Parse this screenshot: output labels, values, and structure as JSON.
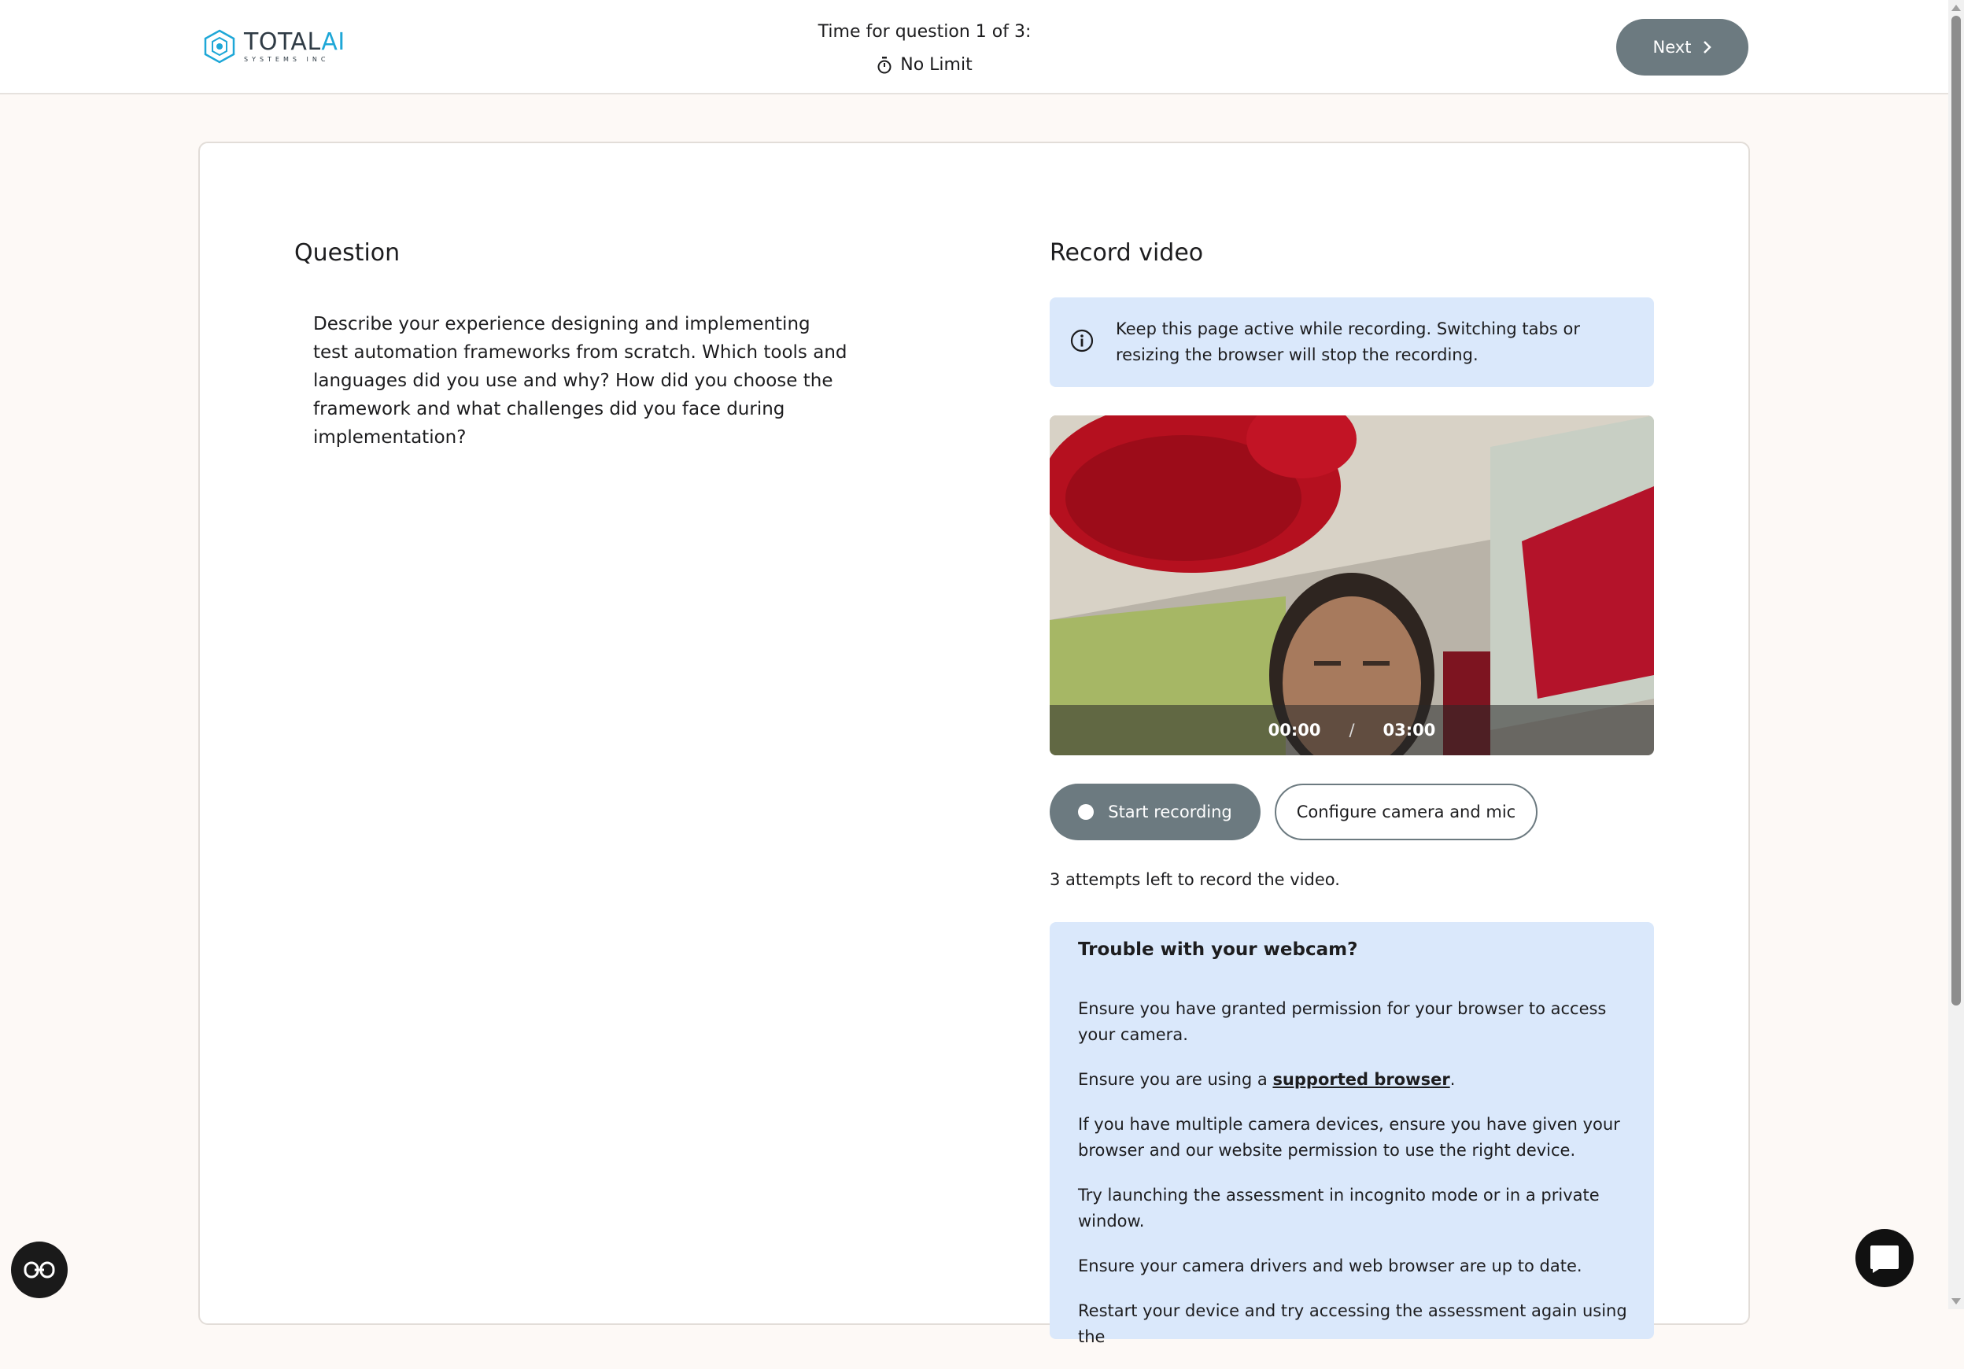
{
  "header": {
    "logo": {
      "main": "TOTAL",
      "accent": "AI",
      "sub": "SYSTEMS INC"
    },
    "timer": {
      "label": "Time for question 1 of 3:",
      "value": "No Limit"
    },
    "next_label": "Next"
  },
  "question": {
    "heading": "Question",
    "text": "Describe your experience designing and implementing test automation frameworks from scratch. Which tools and languages did you use and why? How did you choose the framework and what challenges did you face during implementation?"
  },
  "record": {
    "heading": "Record video",
    "info": "Keep this page active while recording. Switching tabs or resizing the browser will stop the recording.",
    "elapsed": "00:00",
    "separator": "/",
    "limit": "03:00",
    "start_label": "Start recording",
    "configure_label": "Configure camera and mic",
    "attempts": "3 attempts left to record the video."
  },
  "trouble": {
    "heading": "Trouble with your webcam?",
    "tip1": "Ensure you have granted permission for your browser to access your camera.",
    "tip2_prefix": "Ensure you are using a ",
    "tip2_link": "supported browser",
    "tip2_suffix": ".",
    "tip3": "If you have multiple camera devices, ensure you have given your browser and our website permission to use the right device.",
    "tip4": "Try launching the assessment in incognito mode or in a private window.",
    "tip5": "Ensure your camera drivers and web browser are up to date.",
    "tip6": "Restart your device and try accessing the assessment again using the"
  },
  "colors": {
    "primary_button": "#6c7a80",
    "info_bg": "#dae8fb",
    "page_bg": "#fdf9f6",
    "logo_accent": "#1ea7d7"
  },
  "icons": [
    "logo-icon",
    "stopwatch-icon",
    "chevron-right-icon",
    "info-icon",
    "record-dot-icon",
    "accessibility-icon",
    "chat-icon"
  ]
}
